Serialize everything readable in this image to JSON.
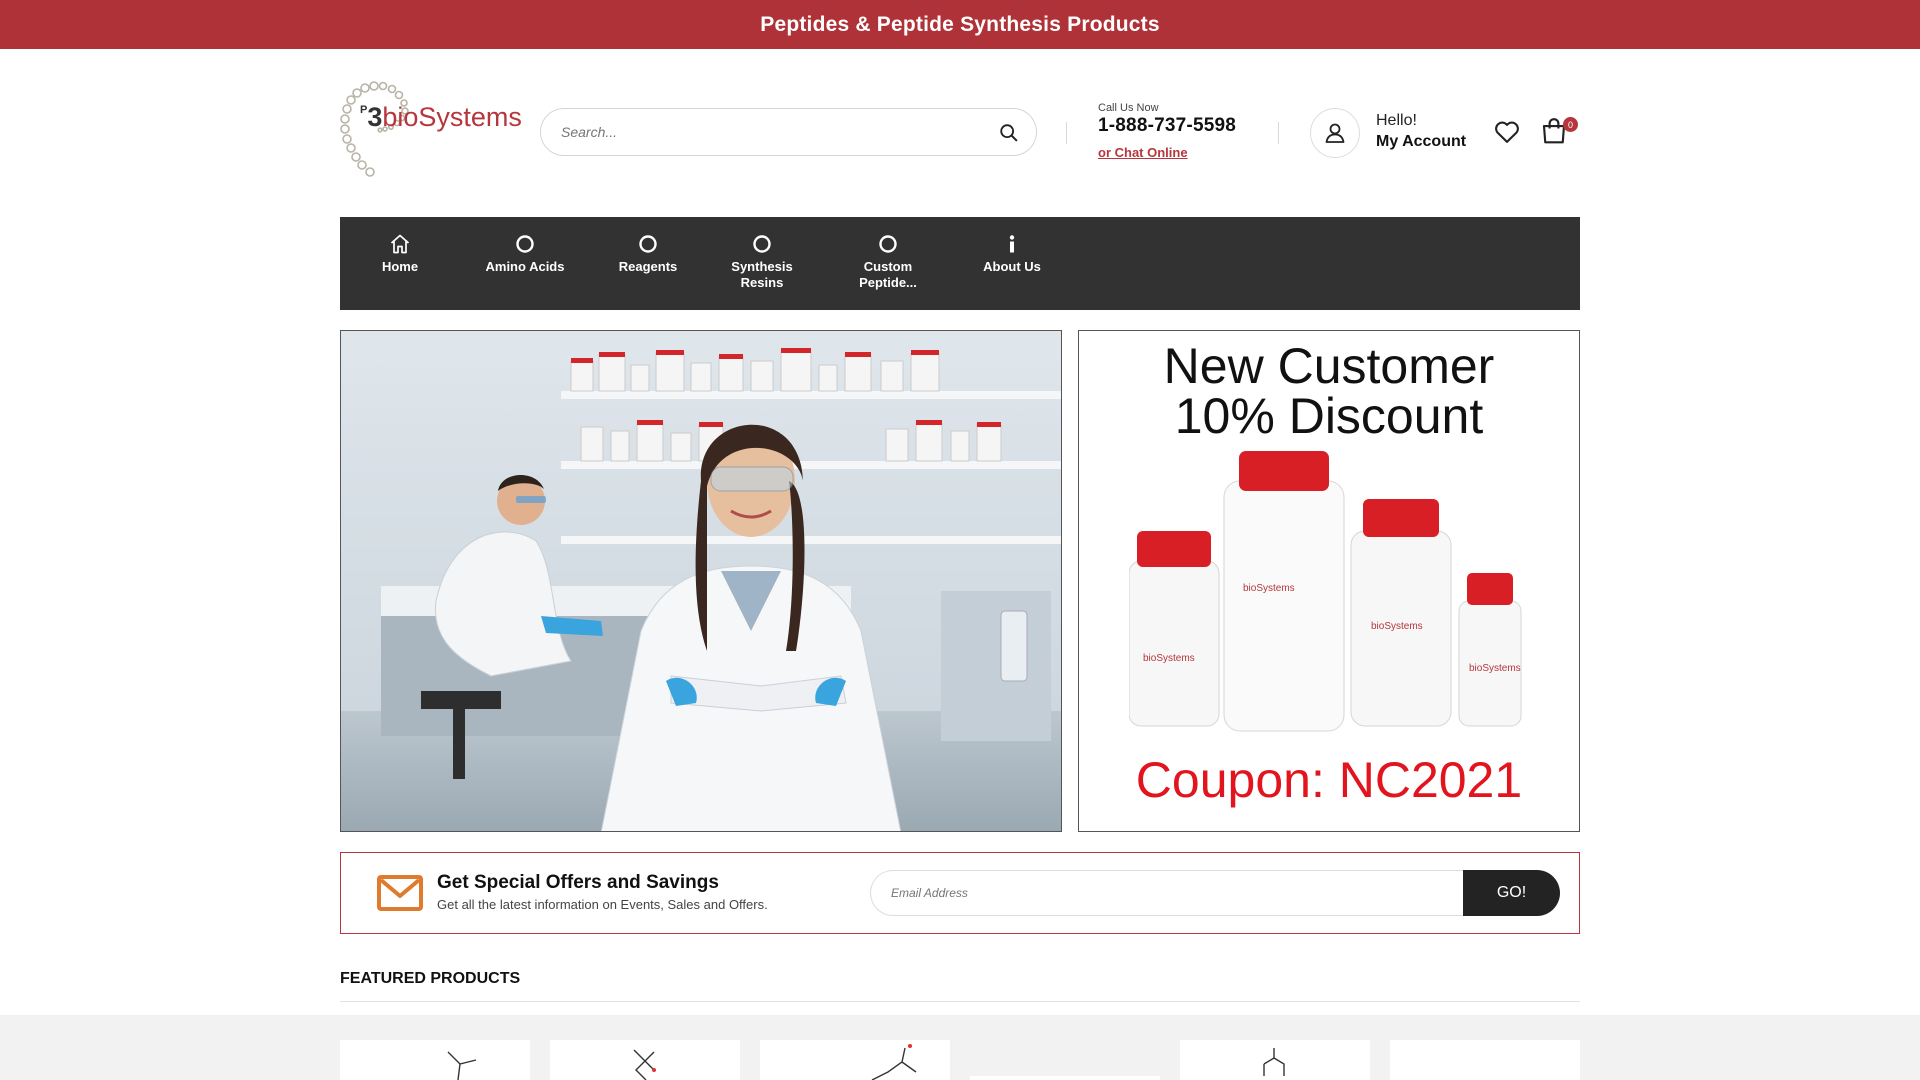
{
  "announcement": "Peptides & Peptide Synthesis Products",
  "logo": {
    "prefix": "P",
    "digit": "3",
    "name": "bioSystems"
  },
  "search": {
    "placeholder": "Search..."
  },
  "contact": {
    "label": "Call Us Now",
    "phone": "1-888-737-5598",
    "chat": "or Chat Online"
  },
  "account": {
    "greeting": "Hello!",
    "label": "My Account"
  },
  "cart": {
    "count": "0"
  },
  "nav": {
    "items": [
      {
        "label": "Home",
        "icon": "home-icon"
      },
      {
        "label": "Amino Acids",
        "icon": "circle-icon"
      },
      {
        "label": "Reagents",
        "icon": "circle-icon"
      },
      {
        "label": "Synthesis Resins",
        "icon": "circle-icon"
      },
      {
        "label": "Custom Peptide...",
        "icon": "circle-icon"
      },
      {
        "label": "About Us",
        "icon": "info-icon"
      }
    ]
  },
  "promo": {
    "headline_1": "New Customer",
    "headline_2": "10% Discount",
    "coupon": "Coupon: NC2021"
  },
  "newsletter": {
    "title": "Get Special Offers and Savings",
    "subtitle": "Get all the latest information on Events, Sales and Offers.",
    "placeholder": "Email Address",
    "button": "GO!"
  },
  "featured": {
    "title": "FEATURED PRODUCTS"
  },
  "colors": {
    "brand": "#ae3237",
    "nav_bg": "#323232",
    "accent_orange": "#e07a2c",
    "coupon_red": "#e2141e"
  }
}
